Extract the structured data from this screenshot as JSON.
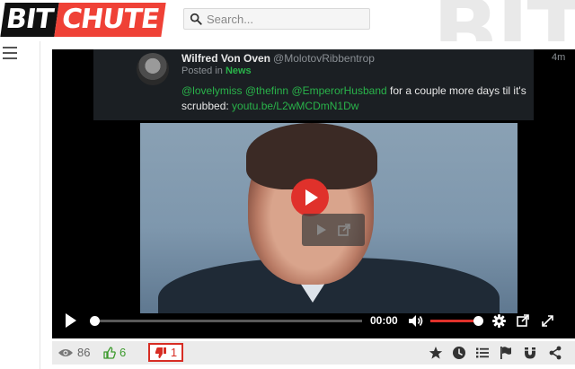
{
  "header": {
    "logo_bit": "BIT",
    "logo_chute": "CHUTE",
    "search_placeholder": "Search...",
    "watermark": "BIT"
  },
  "tweet": {
    "name": "Wilfred Von Oven",
    "handle": "@MolotovRibbentrop",
    "time": "4m",
    "posted_in_label": "Posted in",
    "channel": "News",
    "mentions": [
      "@lovelymiss",
      "@thefinn",
      "@EmperorHusband"
    ],
    "text": "for a couple more days til it's scrubbed:",
    "link": "youtu.be/L2wMCDmN1Dw"
  },
  "player": {
    "current_time": "00:00",
    "progress": 0,
    "volume": 0.95
  },
  "stats": {
    "views": "86",
    "likes": "6",
    "dislikes": "1"
  },
  "colors": {
    "brand_red": "#ef4136",
    "like_green": "#3c9a2d",
    "dislike_red": "#d72d24",
    "tweet_accent": "#29b34a"
  },
  "icons": {
    "views": "eye-icon",
    "likes": "thumbs-up-icon",
    "dislikes": "thumbs-down-icon",
    "actions": [
      "star-icon",
      "clock-icon",
      "list-icon",
      "flag-icon",
      "magnet-icon",
      "share-icon"
    ]
  }
}
